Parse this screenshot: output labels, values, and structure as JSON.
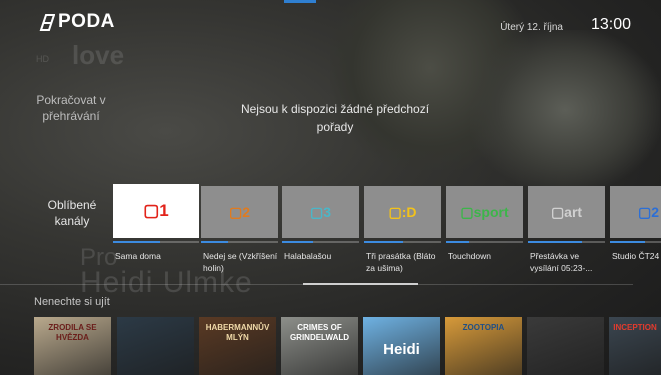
{
  "header": {
    "logo_text": "PODA",
    "date": "Úterý 12. října",
    "time": "13:00"
  },
  "continue_row": {
    "label": "Pokračovat v přehrávání",
    "empty_message": "Nejsou k dispozici žádné předchozí pořady"
  },
  "favorites_row": {
    "label": "Oblíbené kanály",
    "channels": [
      {
        "logo": "▢1",
        "program": "Sama doma",
        "progress": 0.55,
        "color": "#e2231a"
      },
      {
        "logo": "▢2",
        "program": "Nedej se (Vzkříšení holin)",
        "progress": 0.35,
        "color": "#e07b1f"
      },
      {
        "logo": "▢3",
        "program": "Halabalašou",
        "progress": 0.4,
        "color": "#4bb6c8"
      },
      {
        "logo": "▢:D",
        "program": "Tři prasátka (Bláto za ušima)",
        "progress": 0.5,
        "color": "#f2c21b"
      },
      {
        "logo": "▢sport",
        "program": "Touchdown",
        "progress": 0.3,
        "color": "#3db54a"
      },
      {
        "logo": "▢art",
        "program": "Přestávka ve vysílání 05:23-...",
        "progress": 0.7,
        "color": "#d0d0d0"
      },
      {
        "logo": "▢2",
        "program": "Studio ČT24",
        "progress": 0.45,
        "color": "#2c6fd6"
      }
    ]
  },
  "dont_miss_row": {
    "label": "Nenechte si ujít",
    "posters": [
      {
        "caption": "ZRODILA SE HVĚZDA",
        "bg": "#b9a98d",
        "fg": "#6b1d1a"
      },
      {
        "caption": "",
        "bg": "#2c3a46",
        "fg": "#ffffff"
      },
      {
        "caption": "HABERMANNŮV MLÝN",
        "bg": "#5a3a24",
        "fg": "#f0d9a8"
      },
      {
        "caption": "CRIMES OF GRINDELWALD",
        "bg": "#8d8f8a",
        "fg": "#ffffff"
      },
      {
        "caption": "Heidi",
        "bg": "#6fb2e3",
        "fg": "#ffffff"
      },
      {
        "caption": "ZOOTOPIA",
        "bg": "#d79a3a",
        "fg": "#1f4f86"
      },
      {
        "caption": "",
        "bg": "#3a3a3a",
        "fg": "#ffffff"
      },
      {
        "caption": "INCEPTION",
        "bg": "#3b4650",
        "fg": "#e33b2e"
      }
    ]
  },
  "background_watermarks": {
    "channel": "love",
    "hd": "HD",
    "title_pro": "Pro",
    "name": "Heidi Ulmke"
  }
}
